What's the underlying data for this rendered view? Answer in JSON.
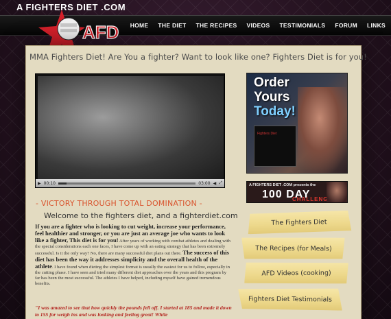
{
  "header": {
    "site_name": "A FIGHTERS DIET .COM",
    "logo_text": "AFD",
    "nav": [
      "HOME",
      "THE DIET",
      "THE RECIPES",
      "VIDEOS",
      "TESTIMONIALS",
      "FORUM",
      "LINKS"
    ]
  },
  "main": {
    "headline": "MMA Fighters Diet! Are You a fighter? Want to look like one? Fighters Diet is for you!",
    "victory": "- VICTORY THROUGH TOTAL DOMINATION -",
    "welcome": "Welcome to the fighters diet, and a fighterdiet.com",
    "intro_bold": "If you are a fighter who is looking to cut weight, increase your performance, feel healthier and stronger, or you are just an average joe who wants to look like a fighter, This diet is for you!",
    "intro_text": " After years of working with combat athletes and dealing with the special considerations each one faces, I have come up with an eating strategy that has been extremely successful. Is it the only way? No, there are many successful diet plans out there. ",
    "success_bold": "The success of this diet has been the way it addresses simplicity and the overall health of the athlete",
    "success_text": ". I have found when dieting the simplest format is usually the easiest for us to follow, especially in the cutting phase. I have seen and tried many different diet approaches over the years and this program by far has been the most successful. The athletes I have helped, including myself have gained tremendous benefits.",
    "quote": "\"I was amazed to see that how quickly the pounds fell off. I started at 185 and made it down to 155 for weigh ins and was looking and feeling great! While"
  },
  "video": {
    "elapsed": "00:10",
    "duration": "03:00",
    "progress": 0.06
  },
  "sidebar": {
    "ad_order": {
      "line1": "Order",
      "line2": "Yours",
      "line3": "Today!",
      "book_title": "Fighters Diet"
    },
    "ad_challenge": {
      "top": "A FIGHTERS DIET .COM presents the",
      "big": "100 DAY",
      "sub": "CHALLENGE!"
    },
    "links": [
      "The Fighters Diet",
      "The Recipes (for Meals)",
      "AFD Videos (cooking)",
      "Fighters Diet Testimonials"
    ]
  },
  "colors": {
    "accent_red": "#d9542e",
    "panel": "#e3dbc1",
    "tape": "#f0dd91"
  }
}
